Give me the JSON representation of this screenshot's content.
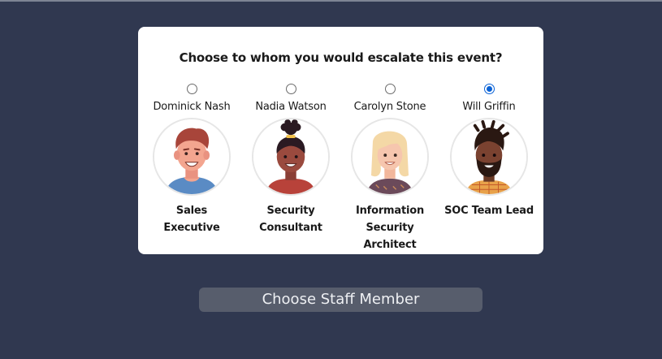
{
  "question": "Choose to whom you would escalate this event?",
  "staff": [
    {
      "name": "Dominick Nash",
      "role": "Sales Executive",
      "selected": false,
      "avatar": "man-red-hair-avatar"
    },
    {
      "name": "Nadia Watson",
      "role": "Security Consultant",
      "selected": false,
      "avatar": "woman-bun-hair-avatar"
    },
    {
      "name": "Carolyn Stone",
      "role": "Information Security Architect",
      "selected": false,
      "avatar": "woman-blonde-hair-avatar"
    },
    {
      "name": "Will Griffin",
      "role": "SOC Team Lead",
      "selected": true,
      "avatar": "man-beard-dreadlocks-avatar"
    }
  ],
  "submit_label": "Choose Staff Member",
  "colors": {
    "background": "#303850",
    "card": "#ffffff",
    "button": "#575d6c",
    "radio_selected": "#0a62d6"
  }
}
